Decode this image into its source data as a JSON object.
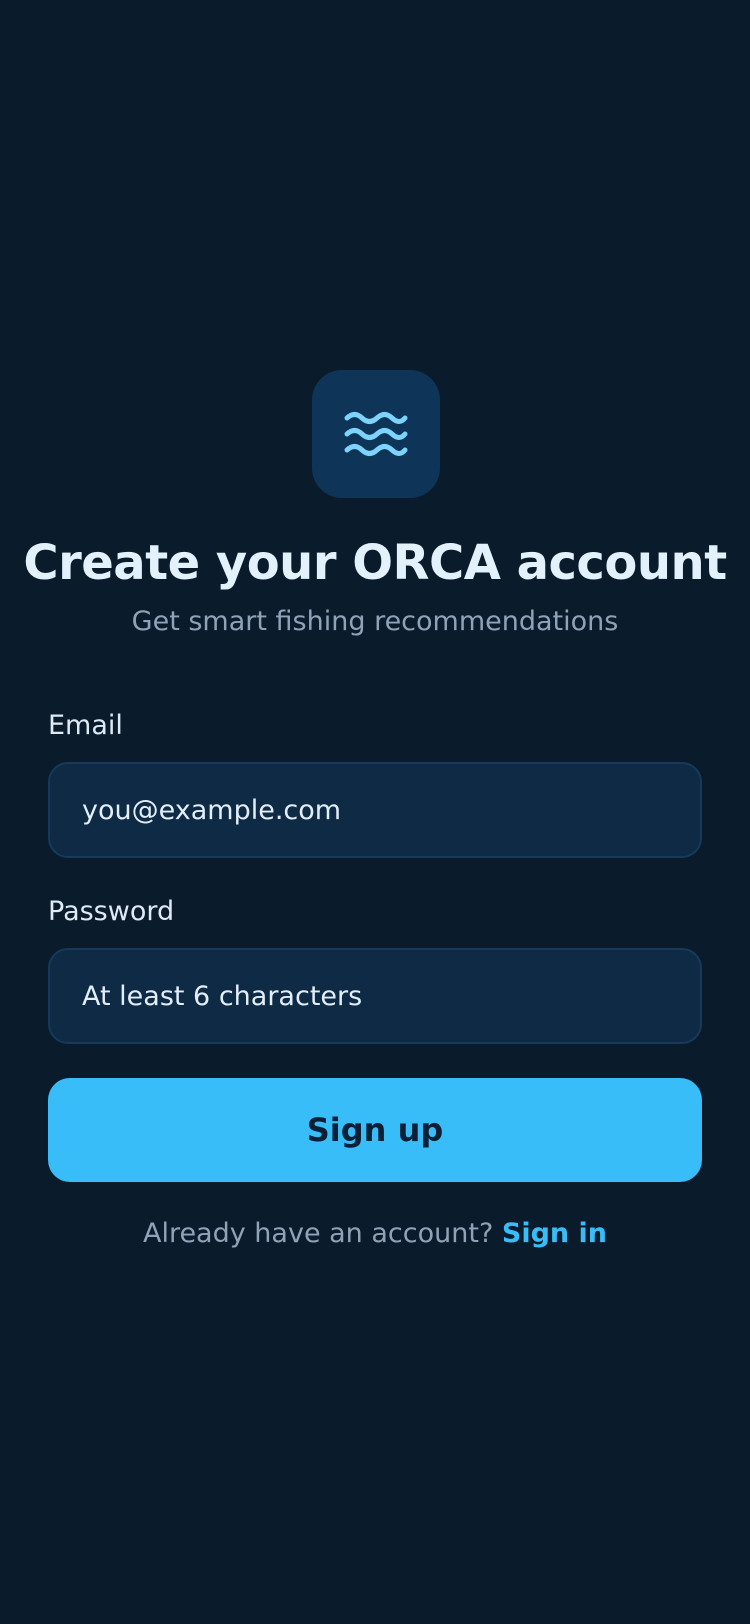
{
  "logo": {
    "icon": "waves-icon",
    "tile_color": "#0e3557",
    "icon_color": "#7dd3fc"
  },
  "header": {
    "title": "Create your ORCA account",
    "subtitle": "Get smart fishing recommendations"
  },
  "form": {
    "email": {
      "label": "Email",
      "placeholder": "you@example.com",
      "value": ""
    },
    "password": {
      "label": "Password",
      "placeholder": "At least 6 characters",
      "value": ""
    },
    "submit_label": "Sign up"
  },
  "footer": {
    "prompt": "Already have an account?",
    "link_label": "Sign in"
  },
  "colors": {
    "background": "#0a1b2b",
    "accent": "#38bdf8",
    "input_background": "#0e2a45",
    "muted_text": "#8fa3b8",
    "title_text": "#e2f1fb"
  }
}
